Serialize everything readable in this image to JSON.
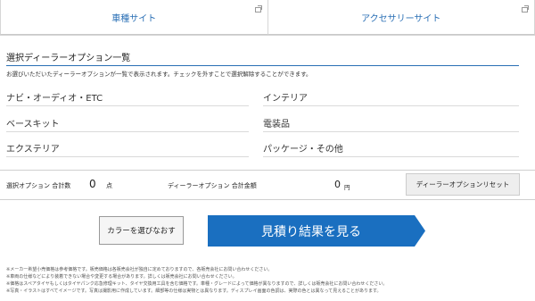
{
  "tabs": [
    {
      "label": "車種サイト",
      "icon": "external-link-icon"
    },
    {
      "label": "アクセサリーサイト",
      "icon": "external-link-icon"
    }
  ],
  "section": {
    "title": "選択ディーラーオプション一覧",
    "description": "お選びいただいたディーラーオプションが一覧で表示されます。チェックを外すことで選択解除することができます。"
  },
  "categories": {
    "navi": "ナビ・オーディオ・ETC",
    "interior": "インテリア",
    "basekit": "ベースキット",
    "electrical": "電装品",
    "exterior": "エクステリア",
    "package": "パッケージ・その他"
  },
  "summary": {
    "count_label": "選択オプション 合計数",
    "count_value": "0",
    "count_unit": "点",
    "total_label": "ディーラーオプション 合計金額",
    "total_value": "0",
    "total_unit": "円",
    "reset_label": "ディーラーオプションリセット"
  },
  "actions": {
    "color_label": "カラーを選びなおす",
    "estimate_label": "見積り結果を見る",
    "estimate_color": "#1a6fc0"
  },
  "notes": [
    "※メーカー希望小売価格は参考価格です。販売価格は各販売会社が独自に定めておりますので、各販売会社にお問い合わせください。",
    "※車両の仕様などにより装着できない場合や変更する場合があります。詳しくは販売会社にお問い合わせください。",
    "※価格はスペアタイヤもしくはタイヤパンク応急修理キット、タイヤ交換用工具を含む価格です。車種・グレードによって価格が異なりますので、詳しくは販売会社にお問い合わせください。",
    "※写真・イラストはすべてイメージです。写真は撮影用に作成しています。細部等の仕様は実物とは異なります。ディスプレイ画面の色調は、実際の色とは異なって見えることがあります。"
  ]
}
